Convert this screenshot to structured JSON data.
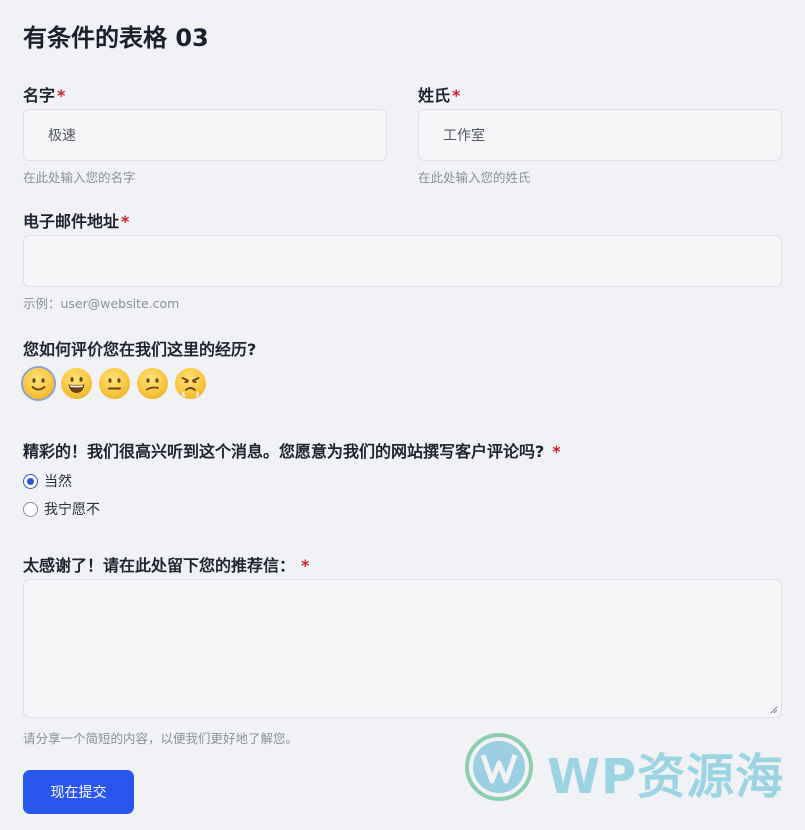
{
  "form": {
    "title": "有条件的表格 03",
    "first_name": {
      "label": "名字",
      "required": "*",
      "value": "极速",
      "hint": "在此处输入您的名字"
    },
    "last_name": {
      "label": "姓氏",
      "required": "*",
      "value": "工作室",
      "hint": "在此处输入您的姓氏"
    },
    "email": {
      "label": "电子邮件地址",
      "required": "*",
      "value": "",
      "hint": "示例：user@website.com"
    },
    "rating": {
      "question": "您如何评价您在我们这里的经历?",
      "options": [
        "slightly-smiling-face-icon",
        "grinning-face-icon",
        "neutral-face-icon",
        "confused-face-icon",
        "angry-face-icon"
      ],
      "selected_index": 0
    },
    "review": {
      "question": "精彩的！我们很高兴听到这个消息。您愿意为我们的网站撰写客户评论吗?",
      "required": "*",
      "options": [
        {
          "label": "当然",
          "checked": true
        },
        {
          "label": "我宁愿不",
          "checked": false
        }
      ]
    },
    "testimonial": {
      "label": "太感谢了！请在此处留下您的推荐信：",
      "required": "*",
      "value": "",
      "hint": "请分享一个简短的内容，以便我们更好地了解您。"
    },
    "submit_label": "现在提交"
  },
  "watermark": {
    "text": "WP资源海",
    "icon": "wordpress-logo-icon"
  },
  "colors": {
    "accent": "#2a56f0",
    "required": "#d0202a",
    "background": "#f0f2f5"
  }
}
